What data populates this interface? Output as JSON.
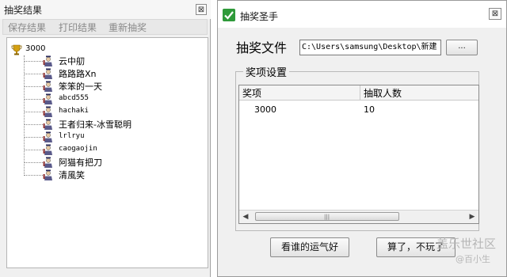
{
  "left_window": {
    "title": "抽奖结果",
    "close_glyph": "⊠",
    "menu": [
      "保存结果",
      "打印结果",
      "重新抽奖"
    ],
    "tree": {
      "root": "3000",
      "children": [
        "云中舠",
        "路路路Xn",
        "笨笨的一天",
        "abcd555",
        "hachaki",
        "王者归来-冰雪聪明",
        "lrlryu",
        "caogaojin",
        "阿猫有把刀",
        "清風笑"
      ]
    },
    "icons": {
      "root": "trophy-icon",
      "child": "person-icon"
    }
  },
  "right_window": {
    "title": "抽奖圣手",
    "close_glyph": "⊠",
    "file_label": "抽奖文件",
    "file_path": "C:\\Users\\samsung\\Desktop\\新建",
    "browse_label": "...",
    "group_title": "奖项设置",
    "columns": [
      "奖项",
      "抽取人数"
    ],
    "rows": [
      [
        "3000",
        "10"
      ]
    ],
    "lucky_button": "看谁的运气好",
    "quit_button": "算了，不玩了",
    "scroll_left": "◀",
    "scroll_right": "▶",
    "scroll_grip": "|||"
  },
  "watermark": {
    "line1": "盖乐世社区",
    "line2": "@百小生"
  },
  "colors": {
    "app_icon": "#2f9a3a",
    "trophy": "#d4a012",
    "menu_disabled_text": "#8a8a8a"
  }
}
